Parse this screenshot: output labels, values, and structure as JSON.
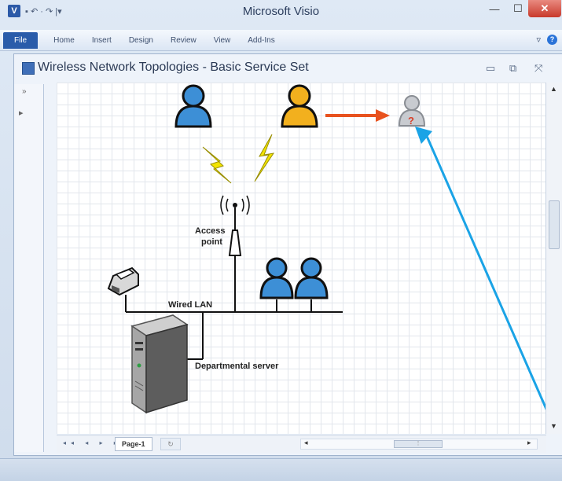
{
  "app": {
    "title": "Microsoft Visio",
    "qat_logo": "V",
    "qat_symbols": "▪ ↶ · ↷ |▾",
    "window_controls": {
      "minimize": "—",
      "maximize": "☐",
      "close": "✕"
    }
  },
  "ribbon": {
    "file_tab": "File",
    "tabs": [
      "Home",
      "Insert",
      "Design",
      "Review",
      "View",
      "Add-Ins"
    ],
    "right_symbols": {
      "expand": "▿",
      "help": "?"
    }
  },
  "document": {
    "title": "Wireless Network Topologies - Basic Service Set",
    "controls": {
      "minimize": "▭",
      "restore": "⧉",
      "close": "⤧"
    }
  },
  "shapes_panel": {
    "expand_symbol": "»",
    "stencil_symbol": "▸"
  },
  "diagram": {
    "labels": {
      "access_point": [
        "Access",
        "point"
      ],
      "wired_lan": "Wired LAN",
      "departmental_server": "Departmental server",
      "unknown_user_mark": "?"
    },
    "colors": {
      "user_blue": "#3d8fd6",
      "user_yellow": "#f2b01e",
      "unknown_user": "#b9bcc2",
      "arrow": "#e8521e",
      "lightning": "#f2e400",
      "annotation_line": "#1aa3e6"
    }
  },
  "page_nav": {
    "nav_symbols": "◂◂ ◂ ▸ ▸▸",
    "page_tab": "Page-1",
    "add_page_symbol": "↻",
    "hscroll_left": "◂",
    "hscroll_thumb": "⋮",
    "hscroll_right": "▸"
  },
  "vscroll": {
    "up": "▲",
    "down": "▼"
  }
}
